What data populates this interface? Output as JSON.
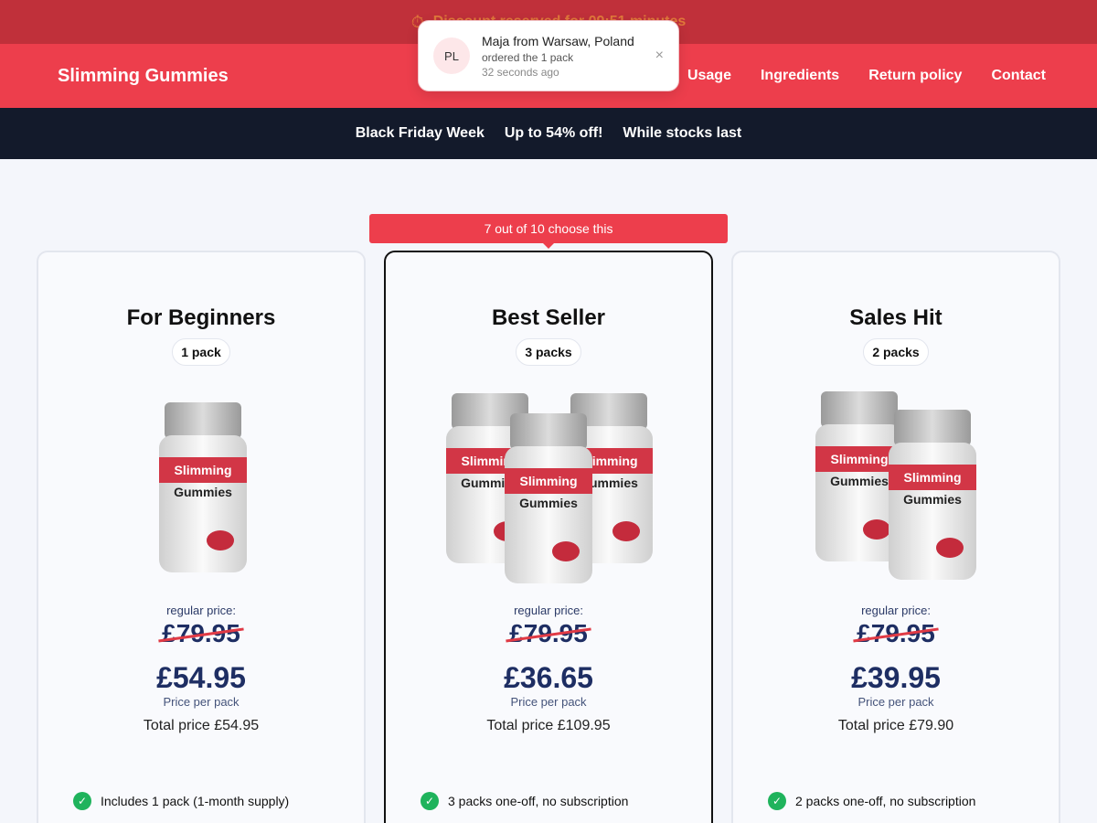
{
  "top_bar": {
    "icon": "clock-icon",
    "text": "Discount reserved for 09:51 minutes"
  },
  "nav": {
    "logo": "Slimming Gummies",
    "links": [
      "Usage",
      "Ingredients",
      "Return policy",
      "Contact"
    ]
  },
  "promo": {
    "items": [
      "Black Friday Week",
      "Up to 54% off!",
      "While stocks last"
    ]
  },
  "toast": {
    "initials": "PL",
    "name": "Maja from Warsaw, Poland",
    "order": "ordered the 1 pack",
    "time": "32 seconds ago",
    "close": "×"
  },
  "ribbon": "7 out of 10 choose this",
  "product": {
    "label_top": "Slimming",
    "label_bottom": "Gummies"
  },
  "plans": [
    {
      "title": "For Beginners",
      "packs": "1 pack",
      "regular_label": "regular price:",
      "old_price": "£79.95",
      "price": "£54.95",
      "per_pack": "Price per pack",
      "total": "Total price £54.95",
      "feature": "Includes 1 pack (1-month supply)"
    },
    {
      "title": "Best Seller",
      "packs": "3 packs",
      "regular_label": "regular price:",
      "old_price": "£79.95",
      "price": "£36.65",
      "per_pack": "Price per pack",
      "total": "Total price £109.95",
      "feature": "3 packs one-off, no subscription"
    },
    {
      "title": "Sales Hit",
      "packs": "2 packs",
      "regular_label": "regular price:",
      "old_price": "£79.95",
      "price": "£39.95",
      "per_pack": "Price per pack",
      "total": "Total price £79.90",
      "feature": "2 packs one-off, no subscription"
    }
  ],
  "colors": {
    "accent": "#ed3e4c",
    "dark": "#131a2b",
    "price": "#1e2e63",
    "check": "#1fb35c"
  }
}
